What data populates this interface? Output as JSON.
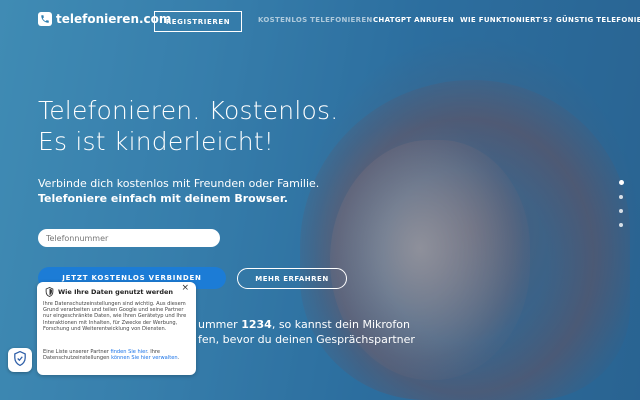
{
  "brand": {
    "name": "telefonieren.com",
    "logo_icon": "phone-icon",
    "color": "#2f7fb0"
  },
  "nav": {
    "register_label": "REGISTRIEREN",
    "links": [
      {
        "label": "KOSTENLOS TELEFONIEREN",
        "active": true
      },
      {
        "label": "CHATGPT ANRUFEN"
      },
      {
        "label": "WIE FUNKTIONIERT'S?"
      },
      {
        "label": "GÜNSTIG TELEFONIERE"
      }
    ]
  },
  "hero": {
    "headline_line1": "Telefonieren. Kostenlos.",
    "headline_line2": "Es ist kinderleicht!",
    "subline": "Verbinde dich kostenlos mit Freunden oder Familie.",
    "subline_bold": "Telefoniere einfach mit deinem Browser.",
    "phone_placeholder": "Telefonnummer",
    "connect_label": "JETZT KOSTENLOS VERBINDEN",
    "more_label": "MEHR ERFAHREN",
    "body_prefix": "ummer ",
    "body_number": "1234",
    "body_suffix": ", so kannst dein Mikrofon",
    "body_line2": "fen, bevor du deinen Gesprächspartner",
    "accent_color": "#1c7cd6"
  },
  "slider": {
    "count": 4,
    "active_index": 0
  },
  "consent": {
    "title": "Wie Ihre Daten genutzt werden",
    "body": "Ihre Datenschutzeinstellungen sind wichtig. Aus diesem Grund verarbeiten und teilen Google und seine Partner nur eingeschränkte Daten, wie Ihren Gerätetyp und Ihre Interaktionen mit Inhalten, für Zwecke der Werbung, Forschung und Weiterentwicklung von Diensten.",
    "list_prefix": "Eine Liste unserer Partner ",
    "list_link": "finden Sie hier",
    "list_middle": ". Ihre Datenschutzeinstellungen ",
    "settings_link": "können Sie hier verwalten",
    "list_suffix": ".",
    "close": "×",
    "link_color": "#1a73e8"
  },
  "privacy_fab": {
    "icon": "shield-check-icon"
  }
}
